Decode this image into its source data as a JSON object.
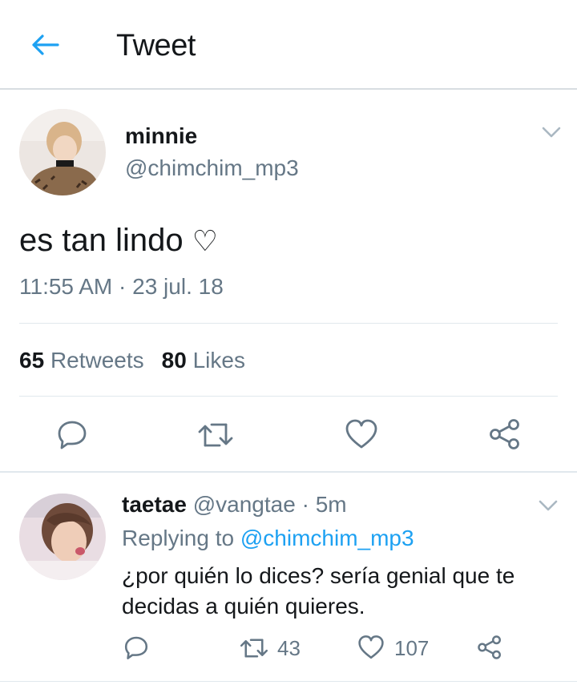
{
  "header": {
    "title": "Tweet"
  },
  "tweet": {
    "name": "minnie",
    "handle": "@chimchim_mp3",
    "text": "es tan lindo",
    "heart_glyph": "♡",
    "time": "11:55 AM",
    "separator": "·",
    "date": "23 jul. 18",
    "retweets_count": "65",
    "retweets_label": "Retweets",
    "likes_count": "80",
    "likes_label": "Likes"
  },
  "reply": {
    "name": "taetae",
    "handle": "@vangtae",
    "separator": "·",
    "age": "5m",
    "replying_label": "Replying to",
    "replying_to": "@chimchim_mp3",
    "text": "¿por quién lo dices? sería genial que te decidas a quién quieres.",
    "retweets": "43",
    "likes": "107"
  },
  "colors": {
    "accent": "#1da1f2",
    "secondary_text": "#657786",
    "icon": "#657786",
    "divider": "#e1e8ed"
  },
  "icons": [
    "back-arrow-icon",
    "chevron-down-icon",
    "reply-icon",
    "retweet-icon",
    "like-icon",
    "share-icon"
  ]
}
